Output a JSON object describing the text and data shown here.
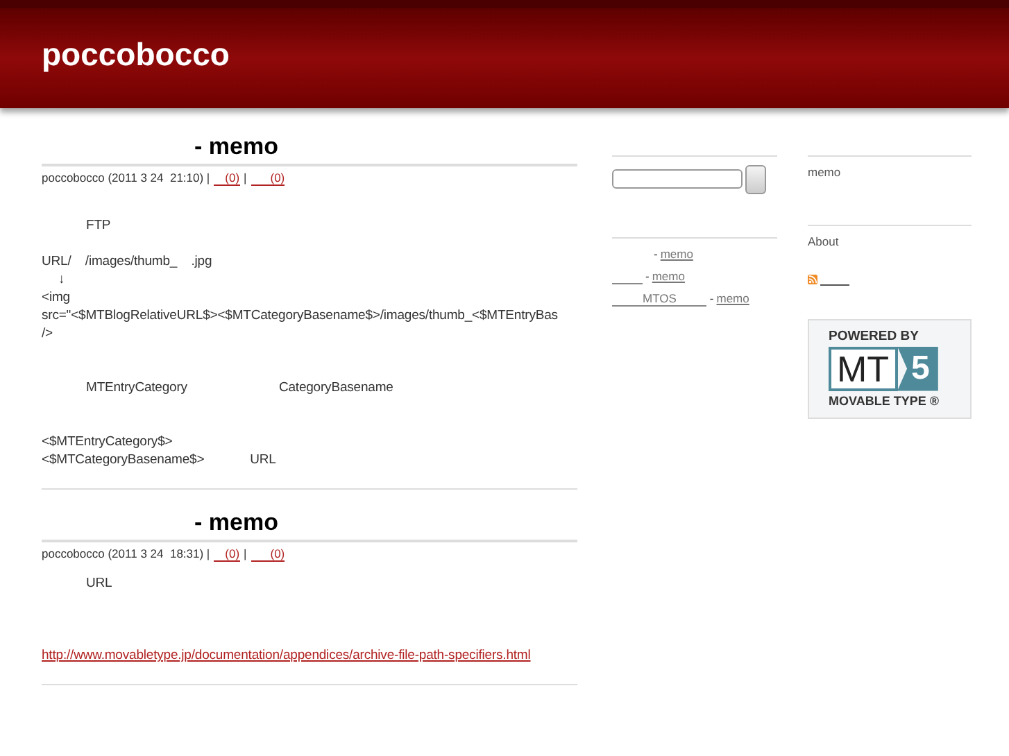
{
  "site_title": "poccobocco",
  "entries": [
    {
      "title": "- memo",
      "meta": "poccobocco (2011 3 24  21:10) |",
      "comments": "(0)",
      "separator": "|",
      "trackbacks": "(0)",
      "body": [
        {
          "kind": "indent",
          "text": "FTP"
        },
        {
          "kind": "gap"
        },
        {
          "kind": "text",
          "text": "URL/    /images/thumb_    .jpg"
        },
        {
          "kind": "arrow",
          "text": "↓"
        },
        {
          "kind": "text",
          "text": "<img"
        },
        {
          "kind": "text",
          "text": "src=\"<$MTBlogRelativeURL$><$MTCategoryBasename$>/images/thumb_<$MTEntryBas"
        },
        {
          "kind": "text",
          "text": "/>"
        },
        {
          "kind": "gap"
        },
        {
          "kind": "gap"
        },
        {
          "kind": "indent",
          "text": "MTEntryCategory                          CategoryBasename"
        },
        {
          "kind": "gap"
        },
        {
          "kind": "gap"
        },
        {
          "kind": "text",
          "text": "<$MTEntryCategory$>"
        },
        {
          "kind": "text",
          "text": "<$MTCategoryBasename$>             URL"
        }
      ]
    },
    {
      "title": "- memo",
      "meta": "poccobocco (2011 3 24  18:31) |",
      "comments": "(0)",
      "separator": "|",
      "trackbacks": "(0)",
      "body": [
        {
          "kind": "indent",
          "text": "URL"
        },
        {
          "kind": "gap"
        },
        {
          "kind": "gap"
        },
        {
          "kind": "gap"
        },
        {
          "kind": "link",
          "text": "http://www.movabletype.jp/documentation/appendices/archive-file-path-specifiers.html"
        }
      ]
    }
  ],
  "recent": [
    {
      "kind": "plain",
      "separator": "-",
      "category": "memo"
    },
    {
      "kind": "linked",
      "separator": "-",
      "category": "memo"
    },
    {
      "kind": "linked",
      "title": "MTOS",
      "separator": "-",
      "category": "memo"
    }
  ],
  "categories": "memo",
  "about": "About",
  "badge": {
    "top": "POWERED BY",
    "mark": "MT",
    "number": "5",
    "bottom": "MOVABLE TYPE ®"
  }
}
